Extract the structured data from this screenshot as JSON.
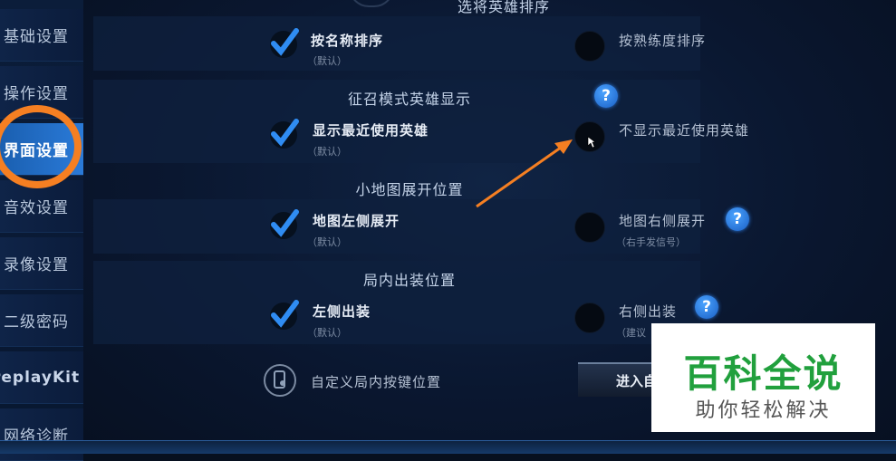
{
  "sidebar": {
    "items": [
      {
        "label": "基础设置"
      },
      {
        "label": "操作设置"
      },
      {
        "label": "界面设置"
      },
      {
        "label": "音效设置"
      },
      {
        "label": "录像设置"
      },
      {
        "label": "二级密码"
      },
      {
        "label": "replayKit"
      },
      {
        "label": "网络诊断"
      }
    ],
    "active_index": 2,
    "highlight_color": "#f57f22"
  },
  "sections": [
    {
      "title": "选将英雄排序",
      "options": [
        {
          "label": "按名称排序",
          "sub": "（默认）",
          "checked": true
        },
        {
          "label": "按熟练度排序",
          "sub": "",
          "checked": false
        }
      ]
    },
    {
      "title": "征召模式英雄显示",
      "help": "?",
      "options": [
        {
          "label": "显示最近使用英雄",
          "sub": "（默认）",
          "checked": true
        },
        {
          "label": "不显示最近使用英雄",
          "sub": "",
          "checked": false
        }
      ]
    },
    {
      "title": "小地图展开位置",
      "options": [
        {
          "label": "地图左侧展开",
          "sub": "（默认）",
          "checked": true
        },
        {
          "label": "地图右侧展开",
          "sub": "（右手发信号）",
          "checked": false,
          "help": "?"
        }
      ]
    },
    {
      "title": "局内出装位置",
      "options": [
        {
          "label": "左侧出装",
          "sub": "（默认）",
          "checked": true
        },
        {
          "label": "右侧出装",
          "sub": "（建议",
          "checked": false,
          "help": "?"
        }
      ]
    }
  ],
  "custom_keys": {
    "label": "自定义局内按键位置",
    "button": "进入自"
  },
  "watermark": {
    "title": "百科全说",
    "subtitle": "助你轻松解决",
    "color": "#21a03d"
  },
  "colors": {
    "accent_check": "#2f8cf2",
    "arrow": "#f57f22"
  }
}
